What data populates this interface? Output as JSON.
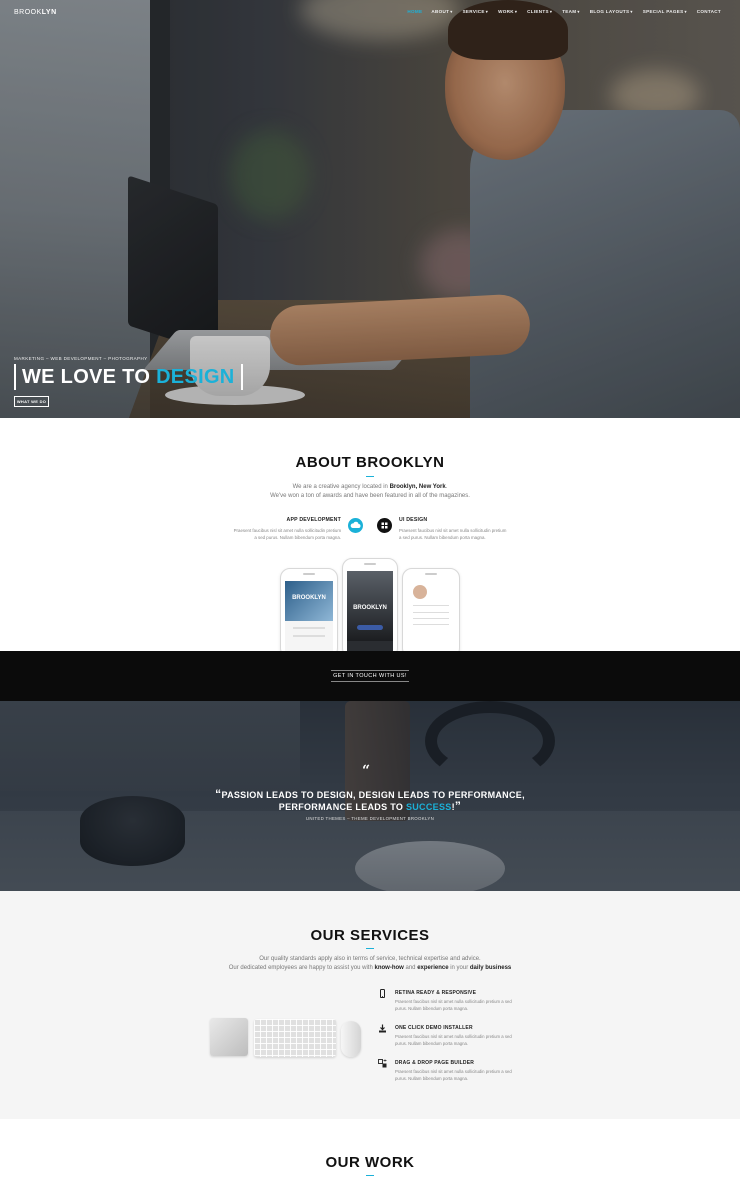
{
  "nav": {
    "logo_light": "BROOK",
    "logo_bold": "LYN",
    "items": [
      {
        "label": "HOME",
        "active": true
      },
      {
        "label": "ABOUT"
      },
      {
        "label": "SERVICE"
      },
      {
        "label": "WORK"
      },
      {
        "label": "CLIENTS"
      },
      {
        "label": "TEAM"
      },
      {
        "label": "BLOG LAYOUTS"
      },
      {
        "label": "SPECIAL PAGES"
      },
      {
        "label": "CONTACT"
      }
    ]
  },
  "hero": {
    "kicker": "MARKETING – WEB DEVELOPMENT – PHOTOGRAPHY",
    "title_main": "WE LOVE TO ",
    "title_accent": "DESIGN",
    "button": "WHAT WE DO"
  },
  "about": {
    "title": "ABOUT BROOKLYN",
    "line1_pre": "We are a creative agency located in ",
    "line1_bold": "Brooklyn, New York",
    "line1_post": ".",
    "line2": "We've won a ton of awards and have been featured in all of the magazines.",
    "features": [
      {
        "title": "APP DEVELOPMENT",
        "icon": "cloud-icon",
        "desc": "Praesent faucibus nisl sit amet nulla sollicitudin pretium a sed purus. Nullam bibendum porta magna."
      },
      {
        "title": "UI DESIGN",
        "icon": "grid-icon",
        "desc": "Praesent faucibus nisl sit amet nulla sollicitudin pretium a sed purus. Nullam bibendum porta magna."
      }
    ],
    "phone_label": "BROOKLYN",
    "cta": "GET IN TOUCH WITH US!"
  },
  "quote": {
    "line1": "PASSION LEADS TO DESIGN, DESIGN LEADS TO PERFORMANCE,",
    "line2_pre": "PERFORMANCE LEADS TO ",
    "line2_accent": "SUCCESS",
    "line2_post": "!",
    "open_mark": "“",
    "close_mark": "”",
    "author": "UNITED THEMES – THEME DEVELOPMENT BROOKLYN"
  },
  "services": {
    "title": "OUR SERVICES",
    "line1": "Our quality standards apply also in terms of service, technical expertise and advice.",
    "line2_pre": "Our dedicated employees are happy to assist you with ",
    "line2_b1": "know-how",
    "line2_mid": " and ",
    "line2_b2": "experience",
    "line2_mid2": " in your ",
    "line2_b3": "daily business",
    "items": [
      {
        "title": "RETINA READY & RESPONSIVE",
        "icon": "mobile-icon",
        "desc": "Praesent faucibus nisl sit amet nulla sollicitudin pretium a sed purus. Nullam bibendum porta magna."
      },
      {
        "title": "ONE CLICK DEMO INSTALLER",
        "icon": "download-icon",
        "desc": "Praesent faucibus nisl sit amet nulla sollicitudin pretium a sed purus. Nullam bibendum porta magna."
      },
      {
        "title": "DRAG & DROP PAGE BUILDER",
        "icon": "drag-drop-icon",
        "desc": "Praesent faucibus nisl sit amet nulla sollicitudin pretium a sed purus. Nullam bibendum porta magna."
      }
    ]
  },
  "work": {
    "title": "OUR WORK"
  },
  "colors": {
    "accent": "#1bb1d8",
    "dark": "#0b0b0b"
  }
}
